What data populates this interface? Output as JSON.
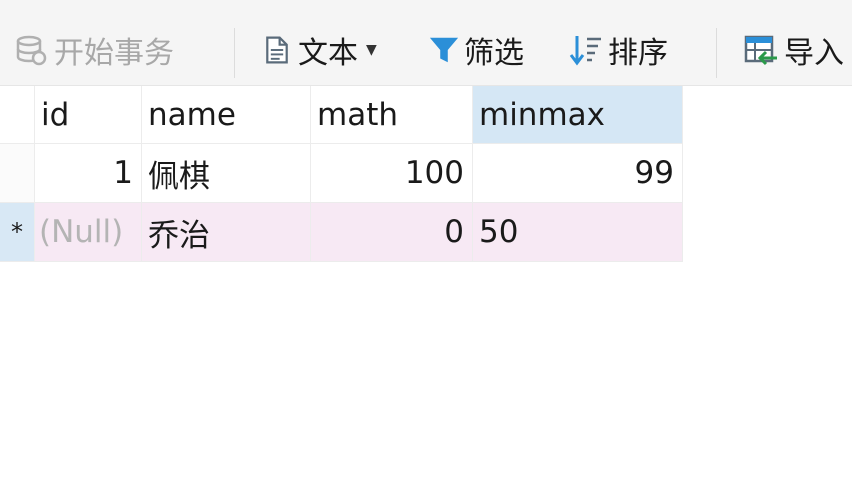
{
  "toolbar": {
    "begin_transaction": "开始事务",
    "text": "文本",
    "filter": "筛选",
    "sort": "排序",
    "import": "导入"
  },
  "grid": {
    "columns": [
      "id",
      "name",
      "math",
      "minmax"
    ],
    "rows": [
      {
        "marker": "",
        "id": "1",
        "name": "佩棋",
        "math": "100",
        "minmax": "99"
      },
      {
        "marker": "*",
        "id": "(Null)",
        "name": "乔治",
        "math": "0",
        "minmax": "50"
      }
    ]
  },
  "colors": {
    "selected_header": "#d5e7f5",
    "editing_row": "#f7e9f4",
    "null_text": "#b4b4b4"
  }
}
